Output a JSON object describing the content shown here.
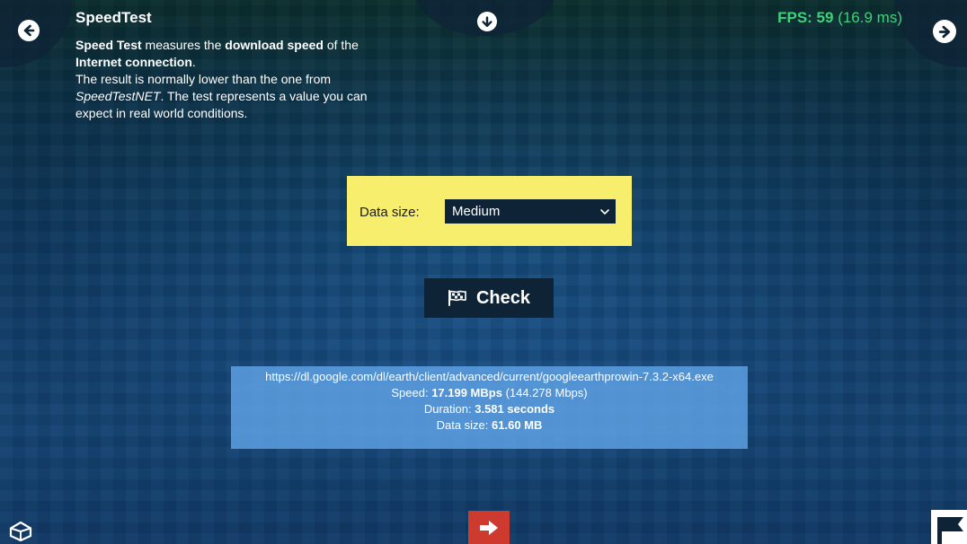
{
  "header": {
    "title": "SpeedTest",
    "description": {
      "l1_bold": "Speed Test",
      "l1_mid": " measures the ",
      "l1_bold2": "download speed",
      "l1_end": " of the",
      "l2_bold": "Internet connection",
      "l2_end": ".",
      "l3": "The result is normally lower than the one from",
      "l4_italic": "SpeedTestNET",
      "l4_end": ". The test represents a value you can",
      "l5": "expect in real world conditions."
    }
  },
  "fps": {
    "label": "FPS: ",
    "value": "59",
    "ms": " (16.9 ms)"
  },
  "data_size": {
    "label": "Data size:",
    "selected": "Medium"
  },
  "check_button": {
    "label": "Check"
  },
  "result": {
    "url": "https://dl.google.com/dl/earth/client/advanced/current/googleearthprowin-7.3.2-x64.exe",
    "speed_label": "Speed: ",
    "speed_value": "17.199 MBps",
    "speed_alt": " (144.278 Mbps)",
    "duration_label": "Duration: ",
    "duration_value": "3.581 seconds",
    "datasize_label": "Data size: ",
    "datasize_value": "61.60 MB"
  },
  "icons": {
    "prev": "arrow-left-circle-icon",
    "next": "arrow-right-circle-icon",
    "down": "arrow-down-circle-icon",
    "check": "checkered-flag-icon",
    "exit": "sign-out-icon",
    "logo": "unity-logo-icon",
    "flag": "flag-icon"
  },
  "colors": {
    "fps": "#3ed27a",
    "panel_yellow": "#f7ee6e",
    "result_blue": "#60a4e6",
    "exit_red": "#cf3a2f"
  }
}
